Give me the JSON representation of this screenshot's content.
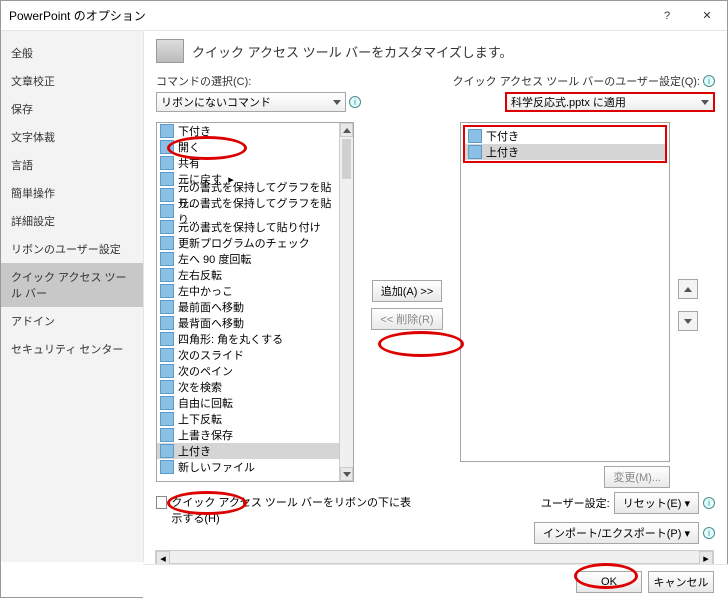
{
  "window": {
    "title": "PowerPoint のオプション"
  },
  "sidebar": {
    "items": [
      {
        "label": "全般"
      },
      {
        "label": "文章校正"
      },
      {
        "label": "保存"
      },
      {
        "label": "文字体裁"
      },
      {
        "label": "言語"
      },
      {
        "label": "簡単操作"
      },
      {
        "label": "詳細設定"
      },
      {
        "label": "リボンのユーザー設定"
      },
      {
        "label": "クイック アクセス ツール バー"
      },
      {
        "label": "アドイン"
      },
      {
        "label": "セキュリティ センター"
      }
    ],
    "selected": 8
  },
  "header": "クイック アクセス ツール バーをカスタマイズします。",
  "left": {
    "label": "コマンドの選択(C):",
    "combo": "リボンにないコマンド",
    "items": [
      "下付き",
      "開く",
      "共有",
      "元に戻す",
      "元の書式を保持してグラフを貼り...",
      "元の書式を保持してグラフを貼り...",
      "元の書式を保持して貼り付け",
      "更新プログラムのチェック",
      "左へ 90 度回転",
      "左右反転",
      "左中かっこ",
      "最前面へ移動",
      "最背面へ移動",
      "四角形: 角を丸くする",
      "次のスライド",
      "次のペイン",
      "次を検索",
      "自由に回転",
      "上下反転",
      "上書き保存",
      "上付き",
      "新しいファイル"
    ],
    "selected": 20
  },
  "right": {
    "label": "クイック アクセス ツール バーのユーザー設定(Q):",
    "combo": "科学反応式.pptx に適用",
    "items": [
      "下付き",
      "上付き"
    ],
    "selected": 1,
    "change_btn": "変更(M)..."
  },
  "mid": {
    "add": "追加(A) >>",
    "remove": "<< 削除(R)"
  },
  "cb_label": "クイック アクセス ツール バーをリボンの下に表示する(H)",
  "user_label": "ユーザー設定:",
  "reset_btn": "リセット(E)",
  "import_btn": "インポート/エクスポート(P)",
  "footer": {
    "ok": "OK",
    "cancel": "キャンセル"
  }
}
